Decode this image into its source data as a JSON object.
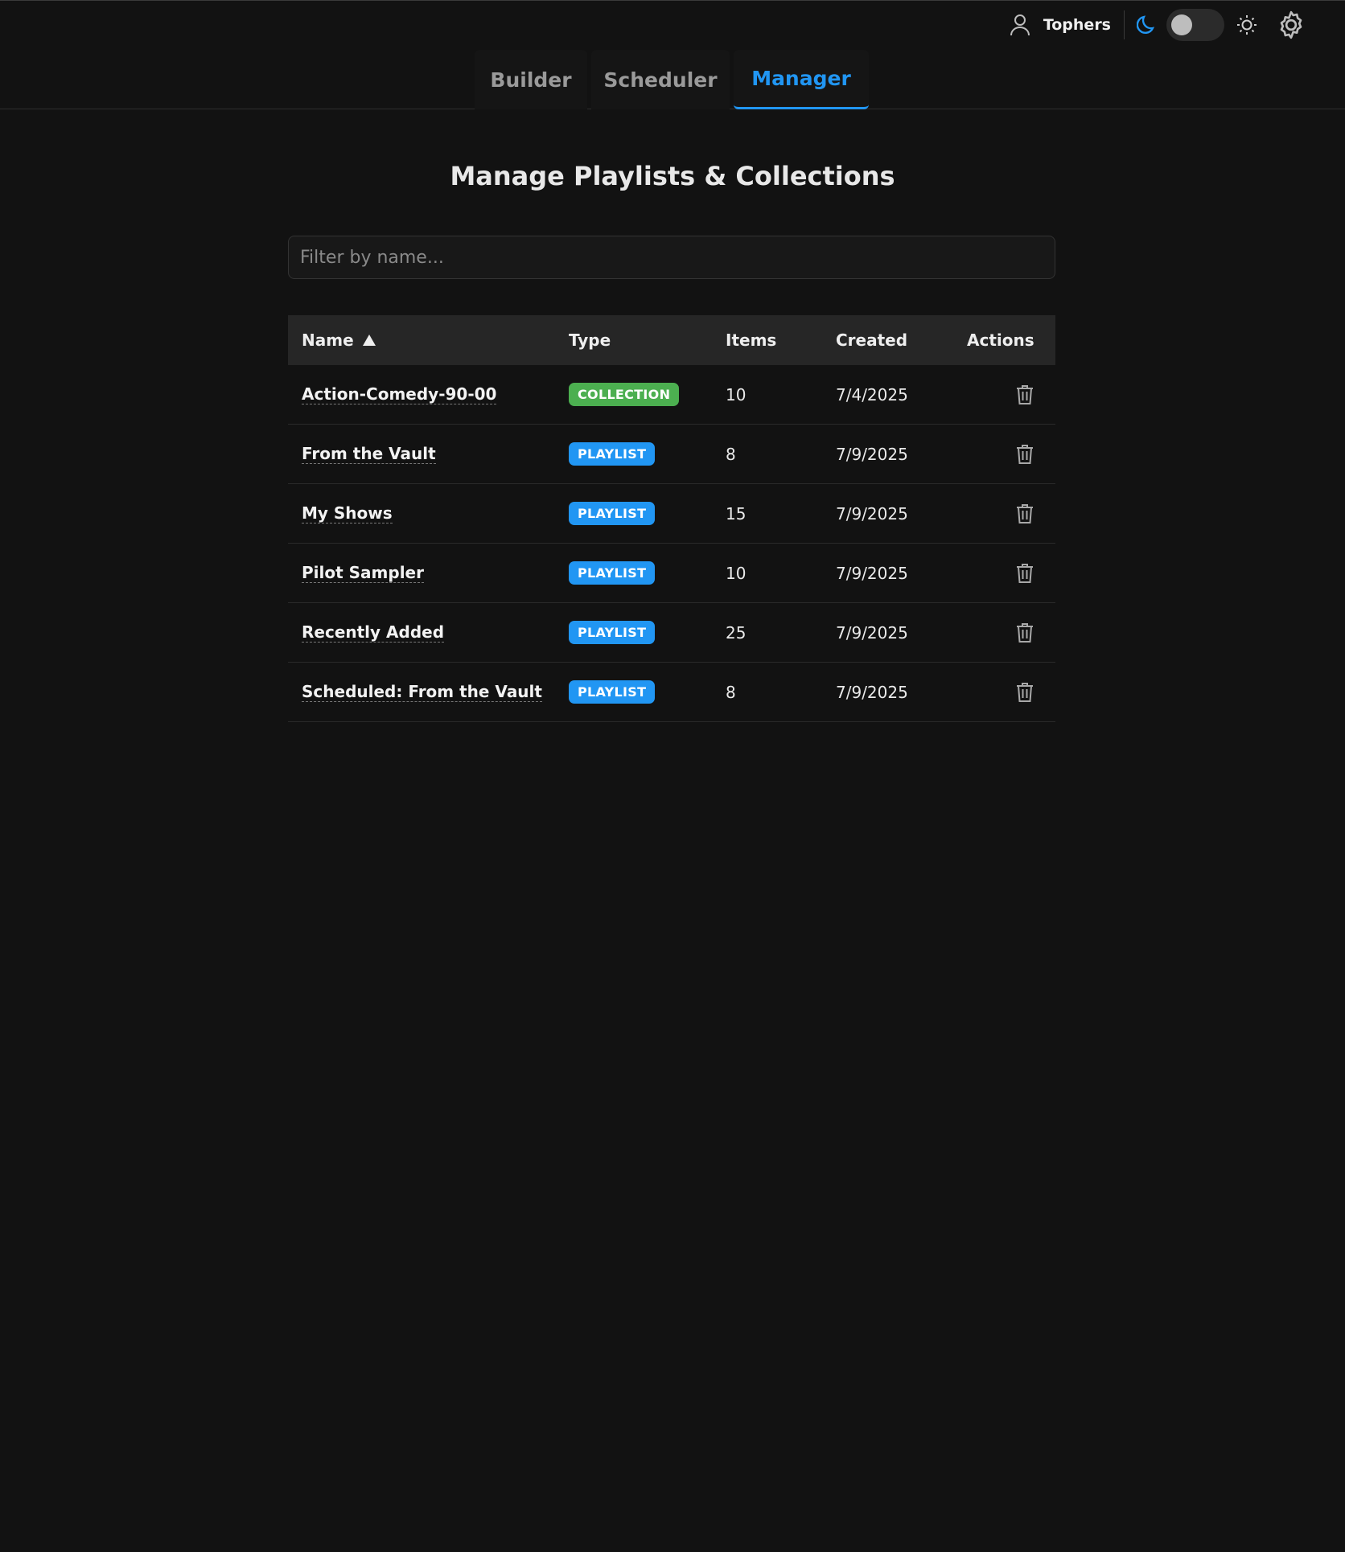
{
  "header": {
    "username": "Tophers",
    "theme_toggle": {
      "mode": "dark"
    },
    "icons": [
      "user-icon",
      "moon-icon",
      "sun-icon",
      "gear-icon"
    ]
  },
  "tabs": [
    {
      "label": "Builder",
      "active": false
    },
    {
      "label": "Scheduler",
      "active": false
    },
    {
      "label": "Manager",
      "active": true
    }
  ],
  "page": {
    "title": "Manage Playlists & Collections",
    "filter_placeholder": "Filter by name...",
    "filter_value": ""
  },
  "table": {
    "columns": [
      "Name",
      "Type",
      "Items",
      "Created",
      "Actions"
    ],
    "sort": {
      "column": "Name",
      "direction": "ascending"
    },
    "rows": [
      {
        "name": "Action-Comedy-90-00",
        "type": "COLLECTION",
        "items": "10",
        "created": "7/4/2025"
      },
      {
        "name": "From the Vault",
        "type": "PLAYLIST",
        "items": "8",
        "created": "7/9/2025"
      },
      {
        "name": "My Shows",
        "type": "PLAYLIST",
        "items": "15",
        "created": "7/9/2025"
      },
      {
        "name": "Pilot Sampler",
        "type": "PLAYLIST",
        "items": "10",
        "created": "7/9/2025"
      },
      {
        "name": "Recently Added",
        "type": "PLAYLIST",
        "items": "25",
        "created": "7/9/2025"
      },
      {
        "name": "Scheduled: From the Vault",
        "type": "PLAYLIST",
        "items": "8",
        "created": "7/9/2025"
      }
    ]
  },
  "colors": {
    "background": "#121212",
    "accent": "#2196f3",
    "playlist_badge": "#2196f3",
    "collection_badge": "#4caf50"
  }
}
